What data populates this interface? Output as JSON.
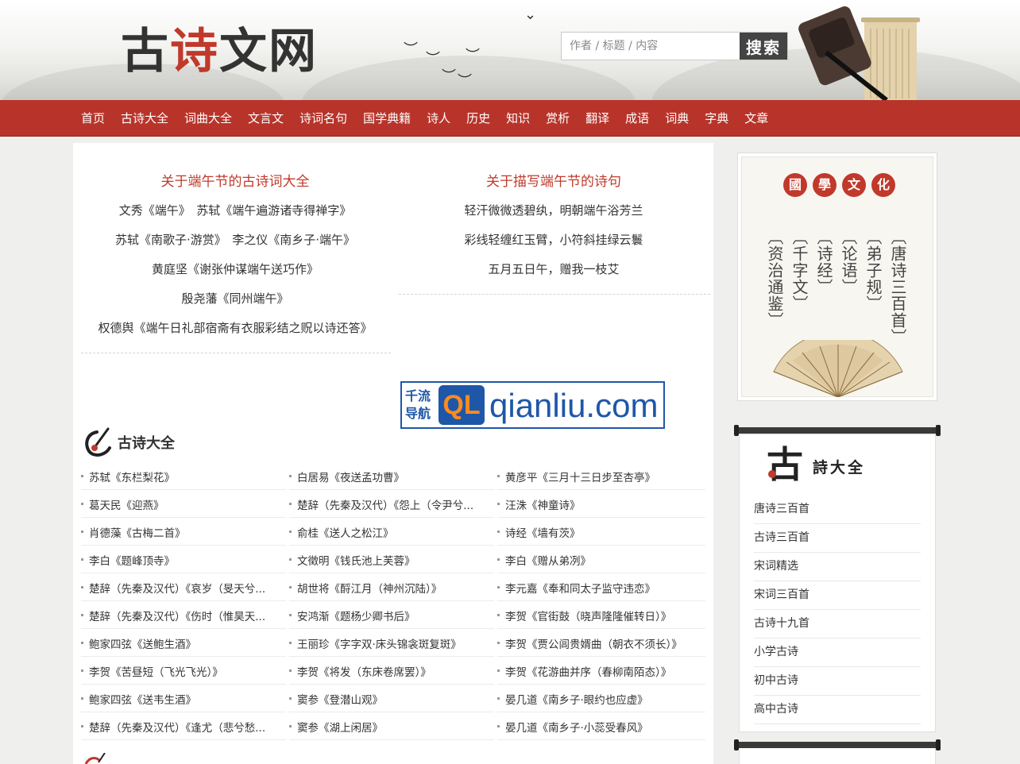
{
  "header": {
    "logo_part1": "古",
    "logo_part2": "诗",
    "logo_part3": "文网",
    "search_placeholder": "作者 / 标题 / 内容",
    "search_button": "搜索"
  },
  "nav": {
    "items": [
      "首页",
      "古诗大全",
      "词曲大全",
      "文言文",
      "诗词名句",
      "国学典籍",
      "诗人",
      "历史",
      "知识",
      "赏析",
      "翻译",
      "成语",
      "词典",
      "字典",
      "文章"
    ]
  },
  "featured": {
    "left": {
      "title": "关于端午节的古诗词大全",
      "lines": [
        "文秀《端午》　苏轼《端午遍游诸寺得禅字》",
        "苏轼《南歌子·游赏》　李之仪《南乡子·端午》",
        "黄庭坚《谢张仲谋端午送巧作》",
        "殷尧藩《同州端午》",
        "权德舆《端午日礼部宿斋有衣服彩结之贶以诗还答》"
      ]
    },
    "right": {
      "title": "关于描写端午节的诗句",
      "lines": [
        "轻汗微微透碧纨，明朝端午浴芳兰",
        "彩线轻缠红玉臂，小符斜挂绿云鬟",
        "五月五日午，赠我一枝艾"
      ]
    }
  },
  "ad": {
    "left_line1": "千流",
    "left_line2": "导航",
    "badge": "QL",
    "domain": "qianliu.com"
  },
  "gushi": {
    "title": "古诗大全",
    "columns": [
      [
        "苏轼《东栏梨花》",
        "葛天民《迎燕》",
        "肖德藻《古梅二首》",
        "李白《题峰顶寺》",
        "楚辞（先秦及汉代）《哀岁（旻天兮...",
        "楚辞（先秦及汉代）《伤时（惟昊天...",
        "鲍家四弦《送鲍生酒》",
        "李贺《苦昼短（飞光飞光）》",
        "鲍家四弦《送韦生酒》",
        "楚辞（先秦及汉代）《逢尤（悲兮愁..."
      ],
      [
        "白居易《夜送孟功曹》",
        "楚辞（先秦及汉代）《怨上（令尹兮...",
        "俞桂《送人之松江》",
        "文徵明《钱氏池上芙蓉》",
        "胡世将《酹江月（神州沉陆）》",
        "安鸿渐《题杨少卿书后》",
        "王丽珍《字字双·床头锦衾斑复斑》",
        "李贺《将发（东床卷席罢）》",
        "窦参《登潜山观》",
        "窦参《湖上闲居》"
      ],
      [
        "黄彦平《三月十三日步至杏亭》",
        "汪洙《神童诗》",
        "诗经《墙有茨》",
        "李白《赠从弟冽》",
        "李元嘉《奉和同太子监守违恋》",
        "李贺《官街鼓（晓声隆隆催转日）》",
        "李贺《贾公闾贵婿曲（朝衣不须长）》",
        "李贺《花游曲并序（春柳南陌态）》",
        "晏几道《南乡子·眼约也应虚》",
        "晏几道《南乡子·小蕊受春风》"
      ]
    ]
  },
  "guoxue": {
    "seals": [
      "國",
      "學",
      "文",
      "化"
    ],
    "books": [
      "〔唐诗三百首〕",
      "〔弟子规〕",
      "〔论语〕",
      "〔诗经〕",
      "〔千字文〕",
      "〔资治通鉴〕"
    ]
  },
  "shi_card": {
    "big_char": "古",
    "title": "詩大全",
    "items": [
      "唐诗三百首",
      "古诗三百首",
      "宋词精选",
      "宋词三百首",
      "古诗十九首",
      "小学古诗",
      "初中古诗",
      "高中古诗"
    ]
  },
  "colors": {
    "brand_red": "#b8342a",
    "title_red": "#c0392b",
    "ad_blue": "#1f57a8",
    "ad_orange": "#ff8a1f"
  },
  "icons": [
    "ink-brush-icon",
    "ink-stone-icon",
    "bird-icon",
    "folding-fan-icon",
    "scroll-rod-icon"
  ]
}
